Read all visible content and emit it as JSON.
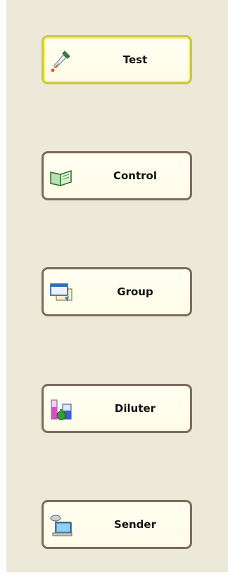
{
  "nav": {
    "items": [
      {
        "label": "Test",
        "icon": "dropper-icon",
        "selected": true
      },
      {
        "label": "Control",
        "icon": "open-book-icon",
        "selected": false
      },
      {
        "label": "Group",
        "icon": "windows-icon",
        "selected": false
      },
      {
        "label": "Diluter",
        "icon": "lab-beakers-icon",
        "selected": false
      },
      {
        "label": "Sender",
        "icon": "network-computer-icon",
        "selected": false
      }
    ]
  },
  "colors": {
    "panel_background": "#ece9d8",
    "button_border": "#7d6b5d",
    "selected_border": "#c9c93a",
    "button_fill": "#fffbe8"
  }
}
